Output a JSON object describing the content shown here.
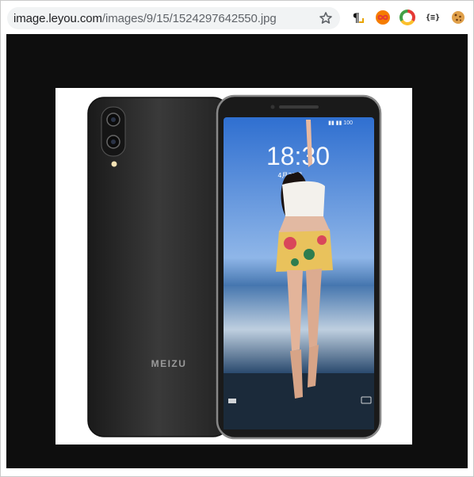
{
  "browser": {
    "url_host": "image.leyou.com",
    "url_path": "/images/9/15/1524297642550.jpg",
    "icons": {
      "bookmark": "star-icon",
      "extensions": [
        "pilcrow-extension-icon",
        "infinity-extension-icon",
        "chrome-circle-extension-icon",
        "json-braces-extension-icon",
        "cookie-extension-icon"
      ]
    },
    "json_ext_label": "{≡}"
  },
  "image": {
    "brand_text": "MEIZU",
    "clock_time": "18:30",
    "clock_date": "4月21日",
    "colors": {
      "viewport_bg": "#0e0e0e",
      "phone_body": "#2a2a2a",
      "screen_sky": "#4f86d6"
    }
  }
}
